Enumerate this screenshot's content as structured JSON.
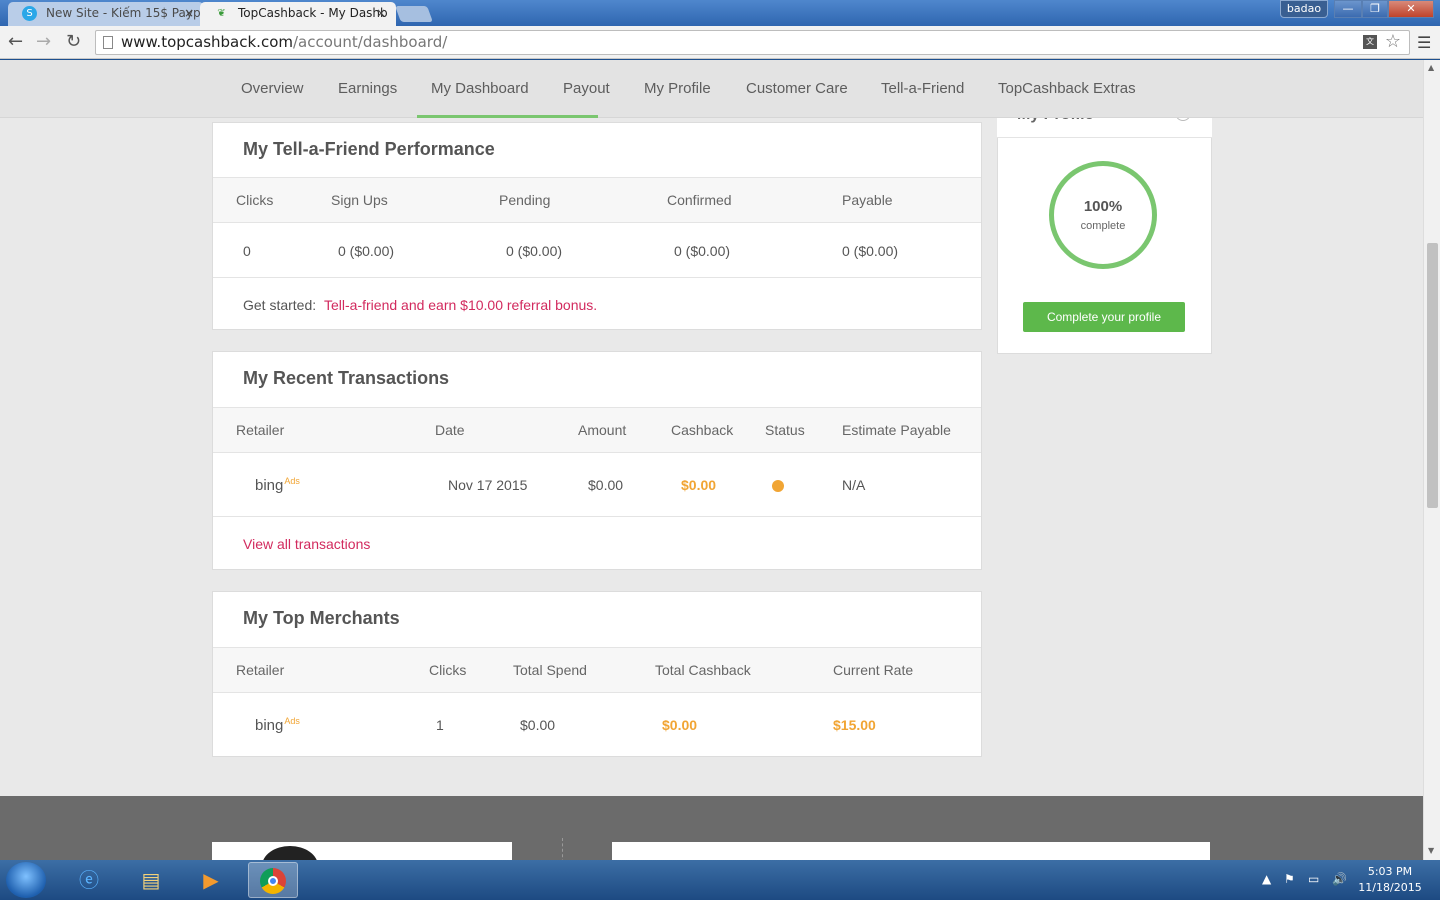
{
  "browser": {
    "tabs": [
      {
        "title": "New Site - Kiếm 15$ Payp",
        "close": "×"
      },
      {
        "title": "TopCashback - My Dashb",
        "close": "×"
      }
    ],
    "user": "badao",
    "url_host": "www.topcashback.com",
    "url_path": "/account/dashboard/"
  },
  "nav": {
    "items": [
      "Overview",
      "Earnings",
      "My Dashboard",
      "Payout",
      "My Profile",
      "Customer Care",
      "Tell-a-Friend",
      "TopCashback Extras"
    ],
    "active": "My Dashboard"
  },
  "tellafriend": {
    "title": "My Tell-a-Friend Performance",
    "headers": [
      "Clicks",
      "Sign Ups",
      "Pending",
      "Confirmed",
      "Payable"
    ],
    "row": [
      "0",
      "0 ($0.00)",
      "0 ($0.00)",
      "0 ($0.00)",
      "0 ($0.00)"
    ],
    "get_started": "Get started:",
    "referral_link": "Tell-a-friend and earn $10.00 referral bonus."
  },
  "transactions": {
    "title": "My Recent Transactions",
    "headers": [
      "Retailer",
      "Date",
      "Amount",
      "Cashback",
      "Status",
      "Estimate Payable"
    ],
    "row": {
      "retailer": "bing",
      "retailer_sup": "Ads",
      "date": "Nov 17 2015",
      "amount": "$0.00",
      "cashback": "$0.00",
      "status_color": "#f1a534",
      "estimate": "N/A"
    },
    "view_all": "View all transactions"
  },
  "merchants": {
    "title": "My Top Merchants",
    "headers": [
      "Retailer",
      "Clicks",
      "Total Spend",
      "Total Cashback",
      "Current Rate"
    ],
    "row": {
      "retailer": "bing",
      "retailer_sup": "Ads",
      "clicks": "1",
      "spend": "$0.00",
      "cashback": "$0.00",
      "rate": "$15.00"
    }
  },
  "profile": {
    "title": "My Profile",
    "percent": "100%",
    "label": "complete",
    "button": "Complete your profile"
  },
  "taskbar": {
    "time": "5:03 PM",
    "date": "11/18/2015"
  },
  "colors": {
    "accent_green": "#7ac66f",
    "accent_orange": "#f1a534",
    "link_pink": "#d22a5e"
  }
}
